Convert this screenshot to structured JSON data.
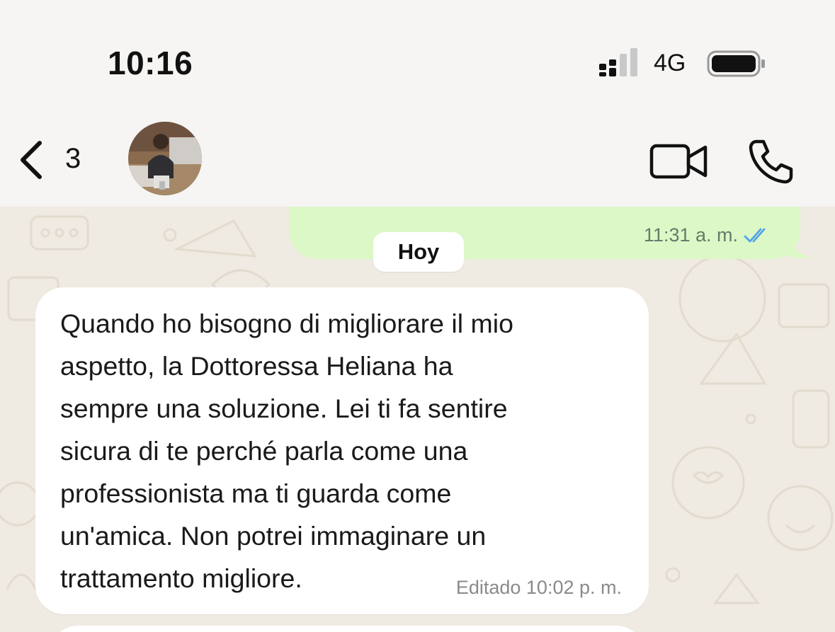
{
  "status_bar": {
    "time": "10:16",
    "network": "4G",
    "signal_icon": "signal-bars-icon",
    "battery_icon": "battery-icon"
  },
  "header": {
    "back_count": "3",
    "back_icon": "chevron-left-icon",
    "video_icon": "video-camera-icon",
    "call_icon": "phone-icon"
  },
  "chat": {
    "outgoing": {
      "time": "11:31 a. m.",
      "status_icon": "double-check-icon"
    },
    "date_separator": "Hoy",
    "incoming": {
      "lines": [
        "Quando ho bisogno di migliorare il mio",
        "aspetto, la Dottoressa Heliana ha",
        "sempre una soluzione. Lei ti fa sentire",
        "sicura di te perché parla come una",
        "professionista ma ti guarda come",
        "un'amica. Non potrei immaginare un",
        "trattamento migliore."
      ],
      "edited_label": "Editado",
      "time": "10:02 p. m."
    }
  },
  "colors": {
    "outgoing_bubble": "#dcf8c6",
    "incoming_bubble": "#ffffff",
    "chat_background": "#efeae2",
    "read_ticks": "#4fa3e8",
    "header_background": "#f6f5f3"
  }
}
